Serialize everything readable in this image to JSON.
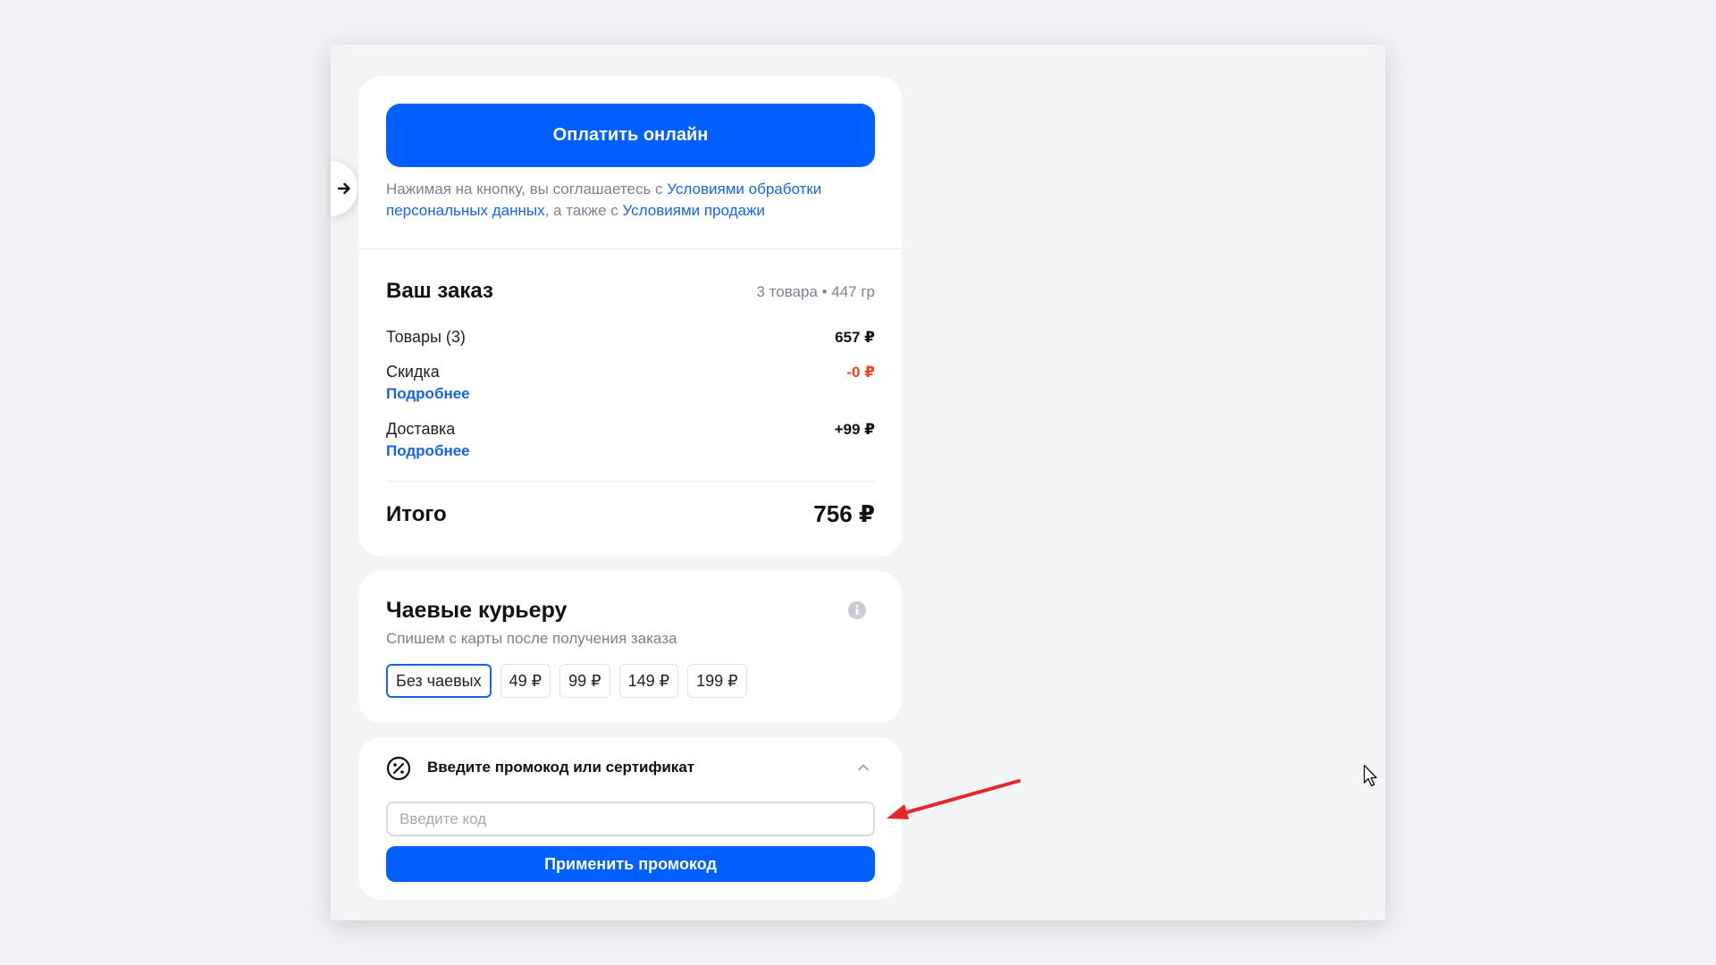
{
  "checkout": {
    "pay_button_label": "Оплатить онлайн",
    "agreement": {
      "prefix": "Нажимая на кнопку, вы соглашаетесь с ",
      "link_personal_data": "Условиями обработки персональных данных",
      "middle": ", а также с ",
      "link_sale_terms": "Условиями продажи"
    }
  },
  "order": {
    "title": "Ваш заказ",
    "meta": "3 товара • 447 гр",
    "rows": [
      {
        "label": "Товары (3)",
        "value": "657 ₽"
      },
      {
        "label": "Скидка",
        "value": "-0 ₽",
        "link": "Подробнее"
      },
      {
        "label": "Доставка",
        "value": "+99 ₽",
        "link": "Подробнее"
      }
    ],
    "total_label": "Итого",
    "total_value": "756 ₽"
  },
  "tips": {
    "title": "Чаевые курьеру",
    "subtitle": "Спишем с карты после получения заказа",
    "options": [
      "Без чаевых",
      "49 ₽",
      "99 ₽",
      "149 ₽",
      "199 ₽"
    ],
    "selected": "Без чаевых"
  },
  "promo": {
    "title": "Введите промокод или сертификат",
    "input_placeholder": "Введите код",
    "apply_label": "Применить промокод"
  },
  "colors": {
    "primary": "#0060ff",
    "link": "#1565e6",
    "discount": "#f0451c",
    "annotation": "#e8262a"
  },
  "icons": [
    "arrow-right-icon",
    "info-icon",
    "percent-badge-icon",
    "chevron-up-icon",
    "annotation-arrow",
    "mouse-pointer-icon"
  ]
}
